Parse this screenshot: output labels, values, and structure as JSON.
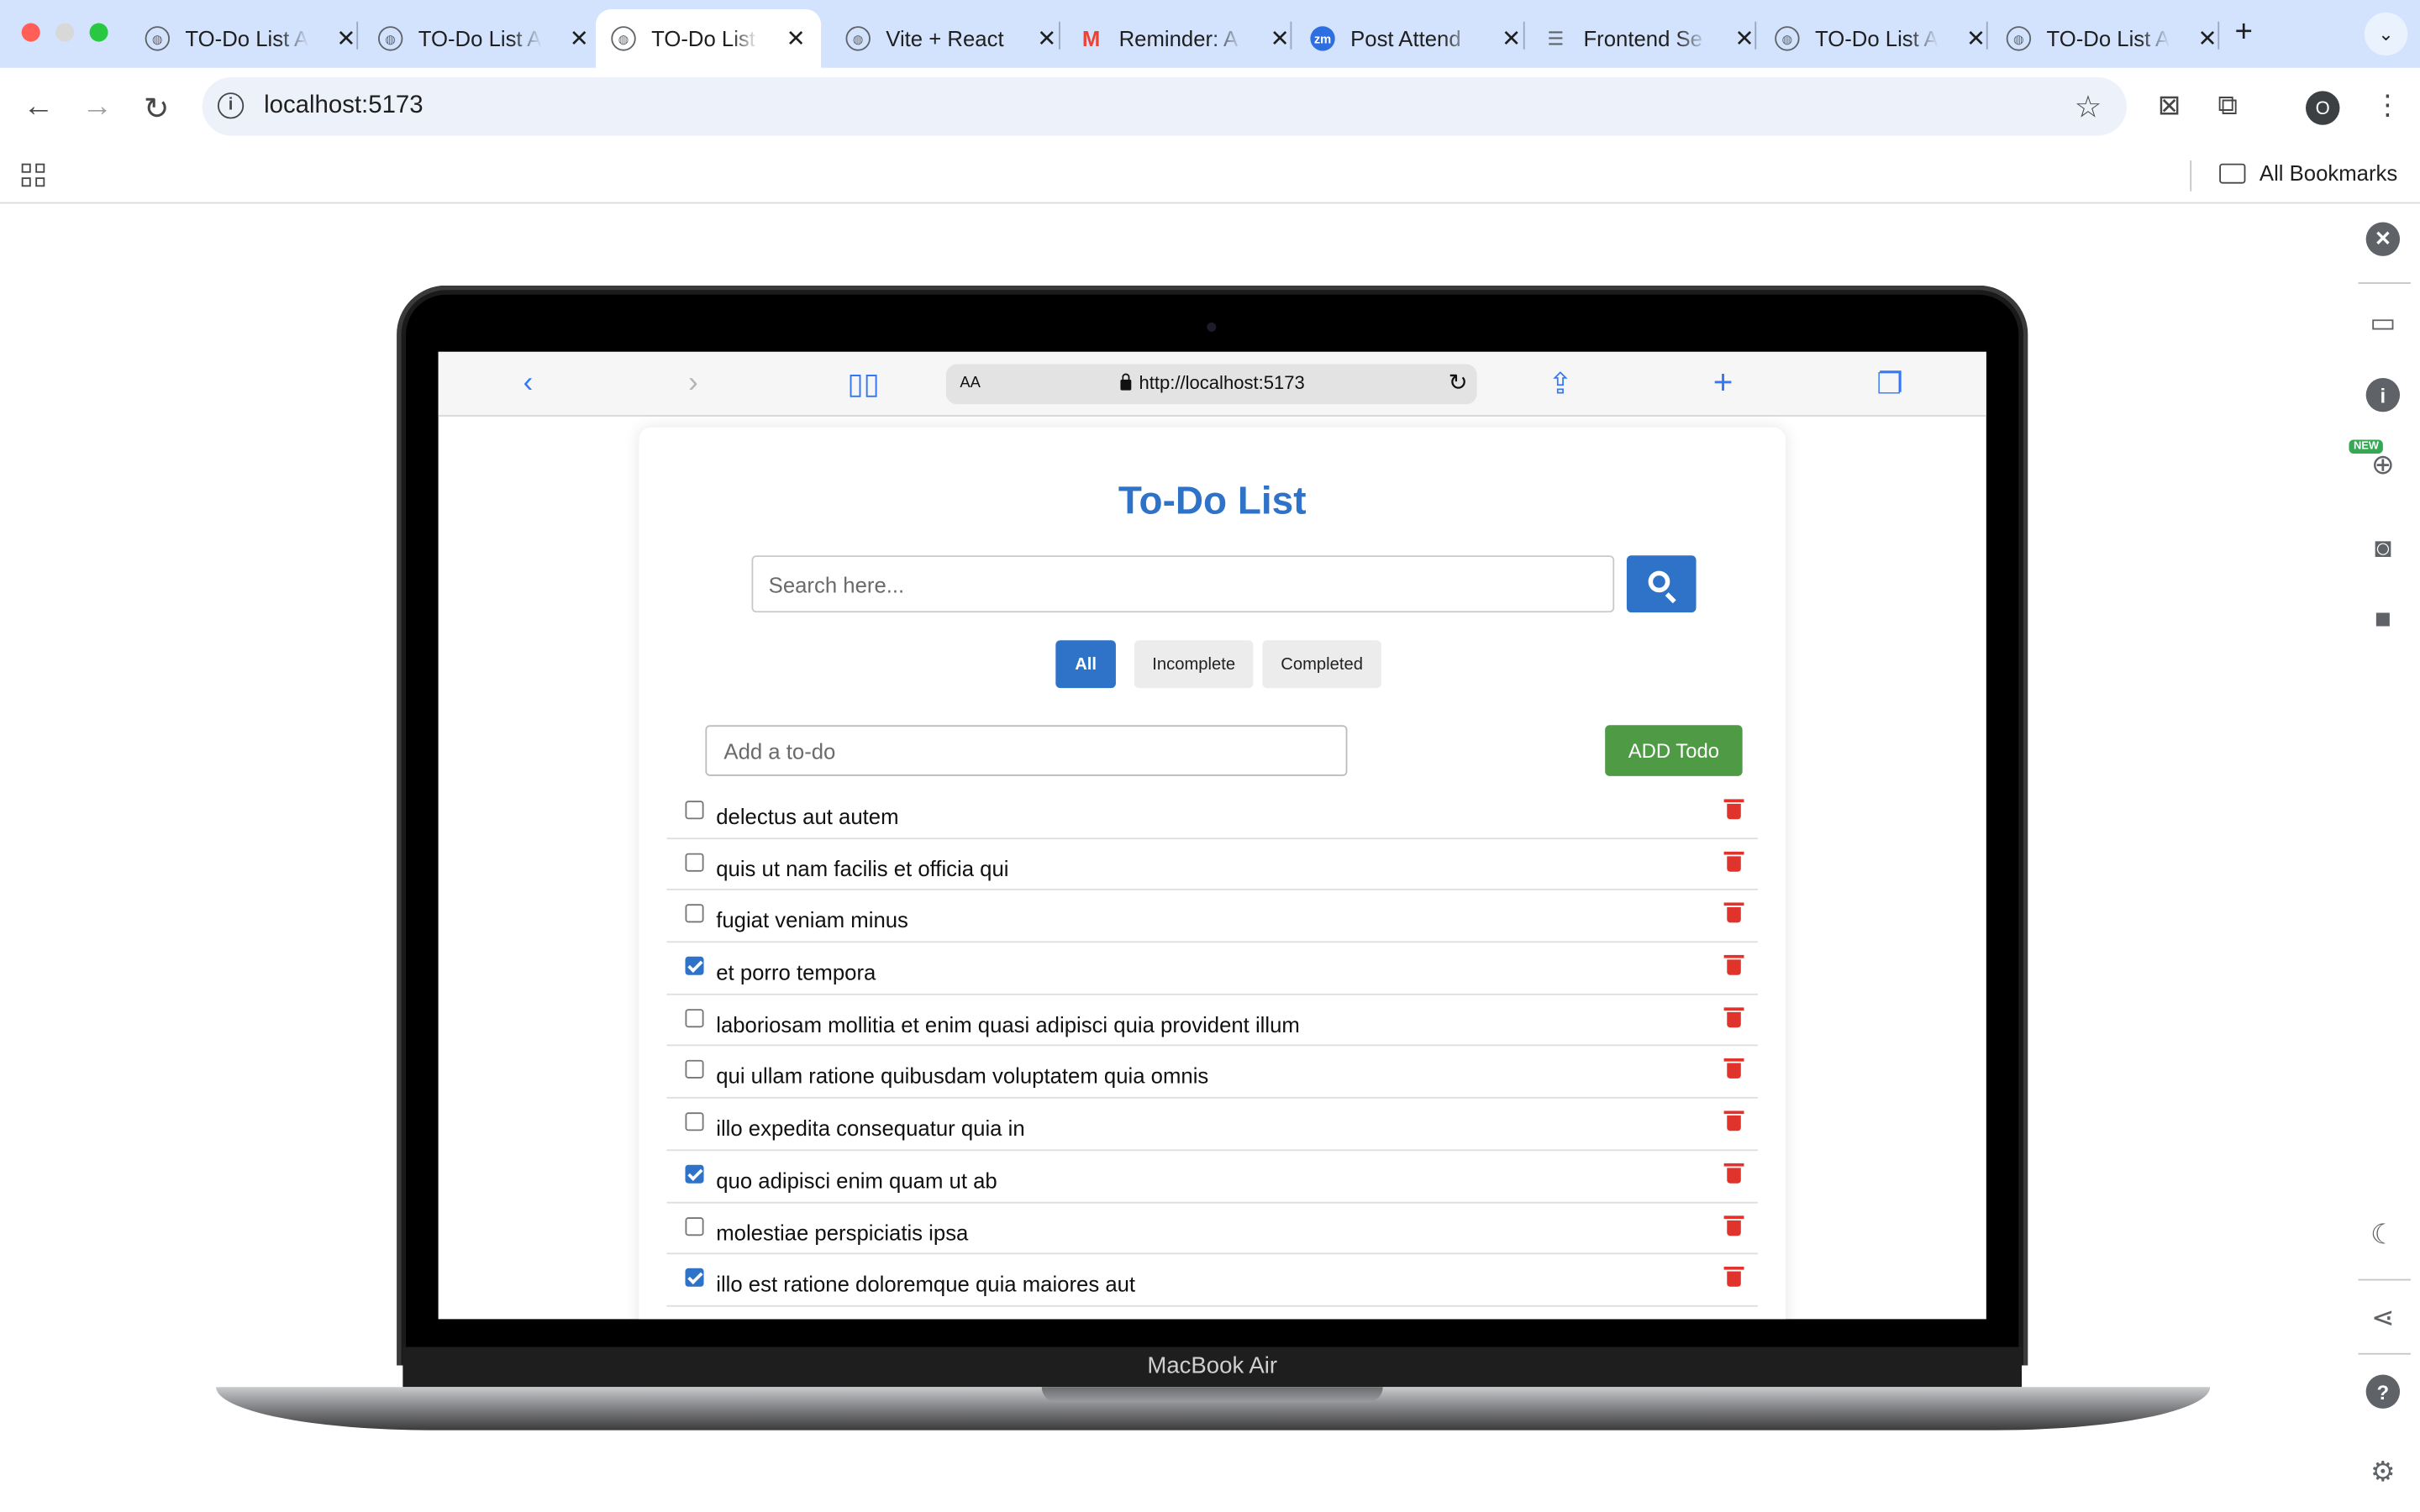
{
  "browser": {
    "tabs": [
      {
        "title": "TO-Do List App",
        "icon": "globe-icon",
        "active": false
      },
      {
        "title": "TO-Do List App",
        "icon": "globe-icon",
        "active": false
      },
      {
        "title": "TO-Do List App",
        "icon": "globe-icon",
        "active": true
      },
      {
        "title": "Vite + React",
        "icon": "globe-icon",
        "active": false
      },
      {
        "title": "Reminder: A",
        "icon": "gmail-icon",
        "active": false
      },
      {
        "title": "Post Attend",
        "icon": "zoom-icon",
        "active": false
      },
      {
        "title": "Frontend Se",
        "icon": "doc-icon",
        "active": false
      },
      {
        "title": "TO-Do List App",
        "icon": "globe-icon",
        "active": false
      },
      {
        "title": "TO-Do List App",
        "icon": "globe-icon",
        "active": false
      }
    ],
    "url": "localhost:5173",
    "profile_initial": "O",
    "bookmarks_label": "All Bookmarks",
    "side_panel_badge": "NEW"
  },
  "device": {
    "label": "MacBook Air"
  },
  "safari": {
    "aa_label": "AA",
    "url": "http://localhost:5173"
  },
  "app": {
    "title": "To-Do List",
    "search_placeholder": "Search here...",
    "filters": [
      "All",
      "Incomplete",
      "Completed"
    ],
    "active_filter": "All",
    "add_placeholder": "Add a to-do",
    "add_button": "ADD Todo",
    "todos": [
      {
        "text": "delectus aut autem",
        "completed": false
      },
      {
        "text": "quis ut nam facilis et officia qui",
        "completed": false
      },
      {
        "text": "fugiat veniam minus",
        "completed": false
      },
      {
        "text": "et porro tempora",
        "completed": true
      },
      {
        "text": "laboriosam mollitia et enim quasi adipisci quia provident illum",
        "completed": false
      },
      {
        "text": "qui ullam ratione quibusdam voluptatem quia omnis",
        "completed": false
      },
      {
        "text": "illo expedita consequatur quia in",
        "completed": false
      },
      {
        "text": "quo adipisci enim quam ut ab",
        "completed": true
      },
      {
        "text": "molestiae perspiciatis ipsa",
        "completed": false
      },
      {
        "text": "illo est ratione doloremque quia maiores aut",
        "completed": true
      }
    ]
  },
  "colors": {
    "accent": "#2f73c9",
    "add_button": "#4e9a45",
    "delete": "#e0332b",
    "tabstrip": "#d3e3fd"
  }
}
